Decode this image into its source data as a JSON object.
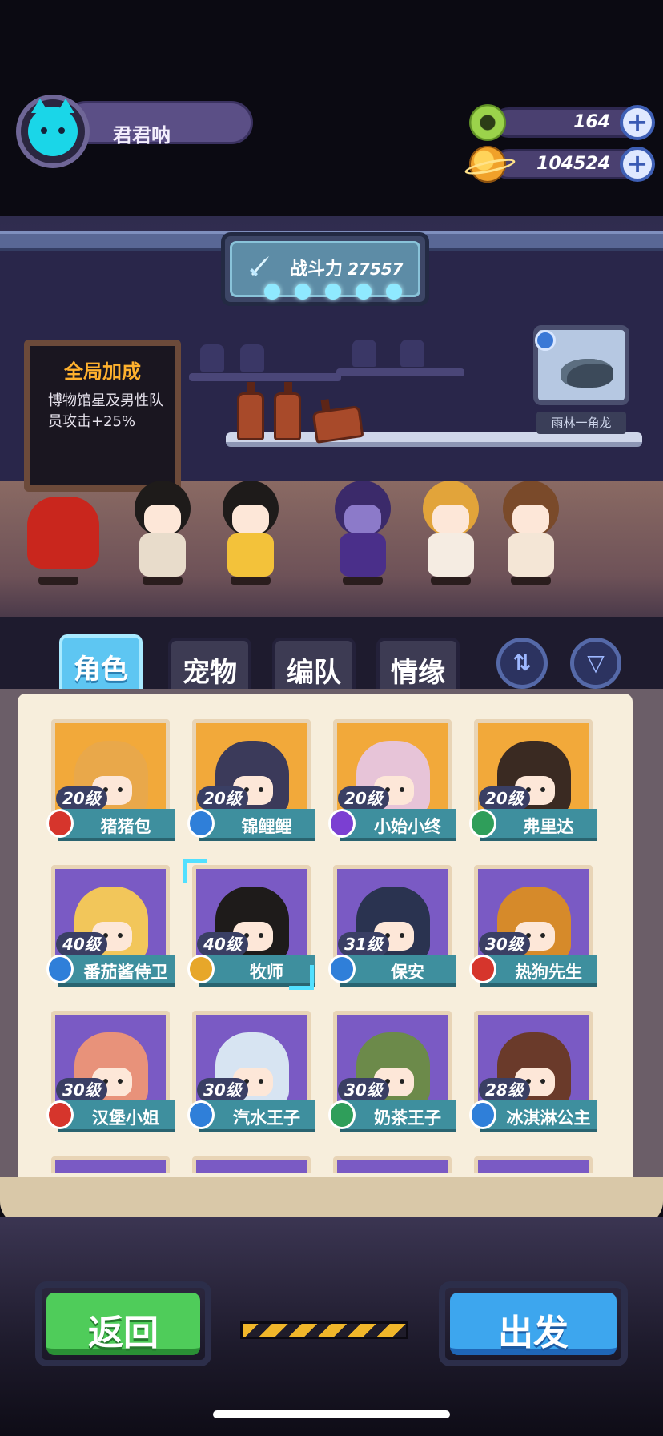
{
  "player": {
    "name": "君君呐"
  },
  "currencies": [
    {
      "icon": "green-donut-icon",
      "value": "164"
    },
    {
      "icon": "planet-coin-icon",
      "value": "104524"
    }
  ],
  "power": {
    "label": "战斗力",
    "value": "27557"
  },
  "notice_board": {
    "title": "全局加成",
    "text": "博物馆星及男性队员攻击+25%"
  },
  "exhibit": {
    "label": "雨林一角龙"
  },
  "tabs": [
    {
      "label": "角色",
      "active": true
    },
    {
      "label": "宠物",
      "active": false
    },
    {
      "label": "编队",
      "active": false
    },
    {
      "label": "情缘",
      "active": false
    }
  ],
  "icon_buttons": {
    "sort": "sort-swap-icon",
    "filter": "filter-icon"
  },
  "characters": [
    {
      "level": "20级",
      "name": "猪猪包",
      "class": "red",
      "bg": "orange"
    },
    {
      "level": "20级",
      "name": "锦鲤鲤",
      "class": "blue",
      "bg": "orange"
    },
    {
      "level": "20级",
      "name": "小始小终",
      "class": "purple",
      "bg": "orange"
    },
    {
      "level": "20级",
      "name": "弗里达",
      "class": "green",
      "bg": "orange"
    },
    {
      "level": "40级",
      "name": "番茄酱侍卫",
      "class": "blue",
      "bg": "purple"
    },
    {
      "level": "40级",
      "name": "牧师",
      "class": "gold",
      "bg": "purple",
      "selected": true
    },
    {
      "level": "31级",
      "name": "保安",
      "class": "blue",
      "bg": "purple"
    },
    {
      "level": "30级",
      "name": "热狗先生",
      "class": "red",
      "bg": "purple"
    },
    {
      "level": "30级",
      "name": "汉堡小姐",
      "class": "red",
      "bg": "purple"
    },
    {
      "level": "30级",
      "name": "汽水王子",
      "class": "blue",
      "bg": "purple"
    },
    {
      "level": "30级",
      "name": "奶茶王子",
      "class": "green",
      "bg": "purple"
    },
    {
      "level": "28级",
      "name": "冰淇淋公主",
      "class": "blue",
      "bg": "purple"
    }
  ],
  "buttons": {
    "back": "返回",
    "go": "出发"
  }
}
